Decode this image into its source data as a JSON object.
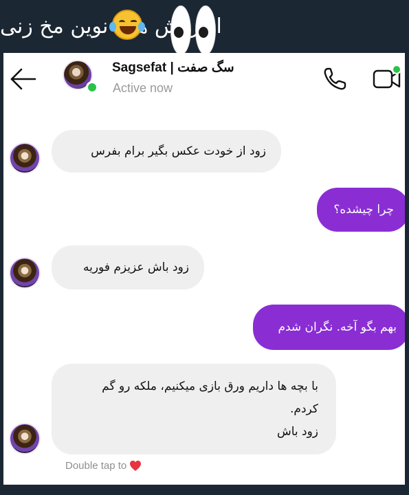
{
  "caption": {
    "text": "از روش های نوین مخ زنی"
  },
  "emojis": {
    "laugh": "face-with-tears-of-joy",
    "eyes": "eyes"
  },
  "chat_header": {
    "contact_name": "Sagsefat | سگ صفت",
    "status": "Active now",
    "online": true
  },
  "messages": [
    {
      "side": "in",
      "text": "زود از خودت عکس بگیر برام بفرس",
      "show_avatar": true
    },
    {
      "side": "out",
      "text": "چرا چیشده؟"
    },
    {
      "side": "in",
      "text": "زود باش عزیزم فوریه",
      "show_avatar": true
    },
    {
      "side": "out",
      "text": "بهم بگو آخه. نگران شدم"
    },
    {
      "side": "in",
      "lines": [
        "با بچه ها داریم ورق بازی میکنیم، ملکه رو گم",
        "کردم.",
        "زود باش"
      ],
      "show_avatar": true
    }
  ],
  "footer": {
    "double_tap_label": "Double tap to"
  },
  "colors": {
    "outgoing_bubble": "#8a2ed4",
    "incoming_bubble": "#efefef",
    "online": "#2bc24a",
    "background": "#1b2733"
  }
}
